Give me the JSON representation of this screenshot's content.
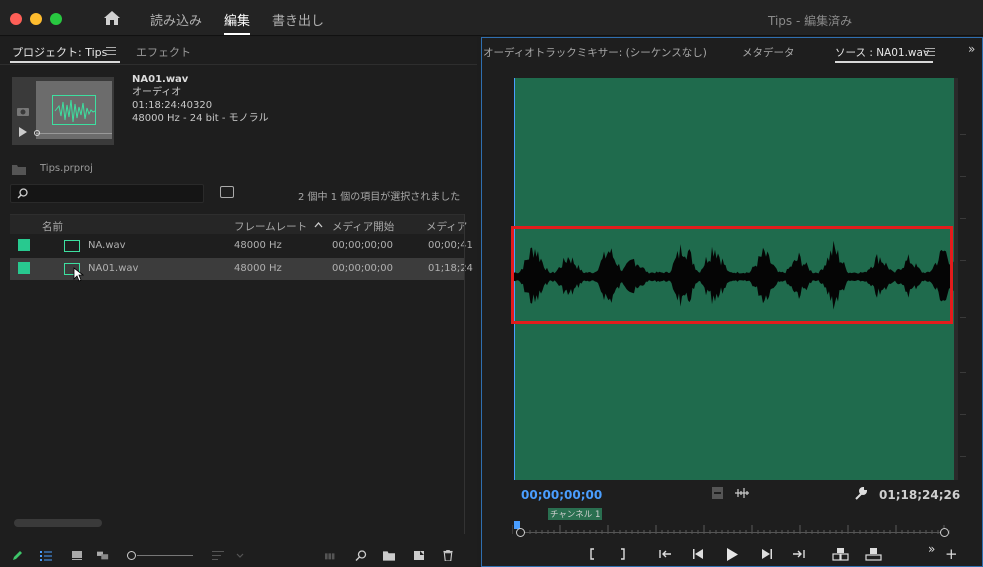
{
  "titlebar": {
    "workspaces": [
      "読み込み",
      "編集",
      "書き出し"
    ],
    "active_workspace": "編集",
    "app_title": "Tips - 編集済み"
  },
  "project_panel": {
    "tabs": [
      "プロジェクト: Tips",
      "エフェクト"
    ],
    "preview": {
      "name": "NA01.wav",
      "type": "オーディオ",
      "duration": "01:18:24:40320",
      "format": "48000 Hz - 24 bit - モノラル"
    },
    "project_file": "Tips.prproj",
    "search": {
      "value": "",
      "placeholder": ""
    },
    "selection_info": "2 個中 1 個の項目が選択されました",
    "columns": [
      "名前",
      "フレームレート",
      "メディア開始",
      "メディア"
    ],
    "rows": [
      {
        "name": "NA.wav",
        "frame_rate": "48000 Hz",
        "media_start": "00;00;00;00",
        "media_end": "00;00;41",
        "selected": false
      },
      {
        "name": "NA01.wav",
        "frame_rate": "48000 Hz",
        "media_start": "00;00;00;00",
        "media_end": "01;18;24",
        "selected": true
      }
    ]
  },
  "source_panel": {
    "tabs": [
      "オーディオトラックミキサー: (シーケンスなし)",
      "メタデータ",
      "ソース : NA01.wav"
    ],
    "active_tab": "ソース : NA01.wav",
    "channel_label": "チャンネル 1",
    "timecode_in": "00;00;00;00",
    "timecode_duration": "01;18;24;26"
  },
  "colors": {
    "waveform_bg": "#1f6b4d",
    "highlight_box": "#e31c1c",
    "accent_blue": "#4a9eff",
    "label_green": "#28c98f"
  },
  "icons": [
    "home-icon",
    "search-icon",
    "new-bin-icon",
    "list-view-icon",
    "icon-view-icon",
    "zoom-slider",
    "play-icon",
    "step-back-icon",
    "step-forward-icon",
    "mark-in-icon",
    "mark-out-icon",
    "wrench-icon",
    "trash-icon"
  ]
}
